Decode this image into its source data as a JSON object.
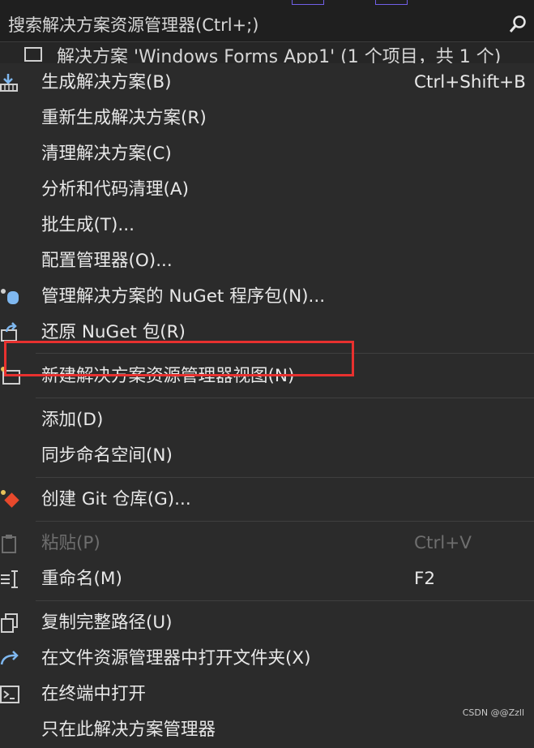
{
  "search": {
    "placeholder": "搜索解决方案资源管理器(Ctrl+;)"
  },
  "tree": {
    "root_label": "解决方案 'Windows Forms App1' (1 个项目，共 1 个)"
  },
  "menu": {
    "items": [
      {
        "label": "生成解决方案(B)",
        "shortcut": "Ctrl+Shift+B"
      },
      {
        "label": "重新生成解决方案(R)"
      },
      {
        "label": "清理解决方案(C)"
      },
      {
        "label": "分析和代码清理(A)"
      },
      {
        "label": "批生成(T)..."
      },
      {
        "label": "配置管理器(O)..."
      },
      {
        "label": "管理解决方案的 NuGet 程序包(N)..."
      },
      {
        "label": "还原 NuGet 包(R)"
      },
      {
        "label": "新建解决方案资源管理器视图(N)"
      },
      {
        "label": "添加(D)"
      },
      {
        "label": "同步命名空间(N)"
      },
      {
        "label": "创建 Git 仓库(G)..."
      },
      {
        "label": "粘贴(P)",
        "shortcut": "Ctrl+V"
      },
      {
        "label": "重命名(M)",
        "shortcut": "F2"
      },
      {
        "label": "复制完整路径(U)"
      },
      {
        "label": "在文件资源管理器中打开文件夹(X)"
      },
      {
        "label": "在终端中打开"
      },
      {
        "label": "只在此解决方案管理器"
      }
    ]
  },
  "watermark": "CSDN @@Zzll",
  "colors": {
    "highlight": "#e8312f",
    "accent": "#7160e8"
  }
}
